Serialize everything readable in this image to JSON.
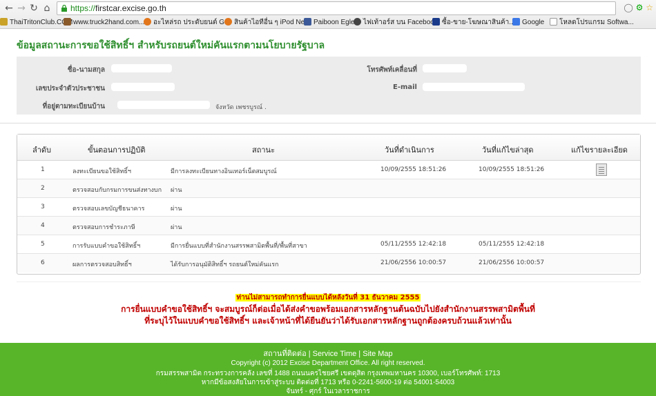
{
  "browser": {
    "url_scheme": "https://",
    "url_host": "firstcar.excise.go.th",
    "bookmarks": [
      {
        "label": "ThaiTritonClub.COM",
        "icon": "car-icon",
        "color": "#c9a227"
      },
      {
        "label": "www.truck2hand.com...",
        "icon": "truck-icon",
        "color": "#8a5a2b"
      },
      {
        "label": "อะไหล่รถ ประดับยนต์ G...",
        "icon": "search-icon",
        "color": "#e2761b"
      },
      {
        "label": "สินค้าไอทีอื่น ๆ iPod Ne...",
        "icon": "search-icon",
        "color": "#e2761b"
      },
      {
        "label": "Paiboon Egle",
        "icon": "facebook-icon",
        "color": "#3b5998"
      },
      {
        "label": "ไฟเท้าอร์ส บน Facebook",
        "icon": "ball-icon",
        "color": "#444444"
      },
      {
        "label": "ซื้อ-ขาย-โฆษณาสินค้า...",
        "icon": "tag-icon",
        "color": "#1a3a8a"
      },
      {
        "label": "Google",
        "icon": "google-icon",
        "color": "#3b78e7"
      },
      {
        "label": "โหลดโปรแกรม Softwa...",
        "icon": "page-icon",
        "color": "#dddddd"
      }
    ]
  },
  "page": {
    "title": "ข้อมูลสถานะการขอใช้สิทธิ์ฯ สำหรับรถยนต์ใหม่คันแรกตามนโยบายรัฐบาล"
  },
  "info": {
    "name_label": "ชื่อ-นามสกุล",
    "id_label": "เลขประจำตัวประชาชน",
    "address_label": "ที่อยู่ตามทะเบียนบ้าน",
    "address_province": "จังหวัด เพชรบูรณ์ .",
    "mobile_label": "โทรศัพท์เคลื่อนที่",
    "email_label": "E-mail"
  },
  "table": {
    "headers": {
      "no": "ลำดับ",
      "step": "ขั้นตอนการปฏิบัติ",
      "status": "สถานะ",
      "date_done": "วันที่ดำเนินการ",
      "date_edit": "วันที่แก้ไขล่าสุด",
      "edit": "แก้ไขรายละเอียด"
    },
    "rows": [
      {
        "no": "1",
        "step": "ลงทะเบียนขอใช้สิทธิ์ฯ",
        "status": "มีการลงทะเบียนทางอินเทอร์เน็ตสมบูรณ์",
        "date_done": "10/09/2555 18:51:26",
        "date_edit": "10/09/2555 18:51:26"
      },
      {
        "no": "2",
        "step": "ตรวจสอบกับกรมการขนส่งทางบก",
        "status": "ผ่าน",
        "date_done": "",
        "date_edit": ""
      },
      {
        "no": "3",
        "step": "ตรวจสอบเลขบัญชีธนาคาร",
        "status": "ผ่าน",
        "date_done": "",
        "date_edit": ""
      },
      {
        "no": "4",
        "step": "ตรวจสอบการชำระภาษี",
        "status": "ผ่าน",
        "date_done": "",
        "date_edit": ""
      },
      {
        "no": "5",
        "step": "การรับแบบคำขอใช้สิทธิ์ฯ",
        "status": "มีการยื่นแบบที่สำนักงานสรรพสามิตพื้นที่/พื้นที่สาขา",
        "date_done": "05/11/2555 12:42:18",
        "date_edit": "05/11/2555 12:42:18"
      },
      {
        "no": "6",
        "step": "ผลการตรวจสอบสิทธิ์ฯ",
        "status": "ได้รับการอนุมัติสิทธิ์ฯ รถยนต์ใหม่คันแรก",
        "date_done": "21/06/2556 10:00:57",
        "date_edit": "21/06/2556 10:00:57"
      }
    ]
  },
  "notice": {
    "deadline": "ท่านไม่สามารถทำการยื่นแบบได้หลังวันที่ 31 ธันวาคม 2555",
    "line1": "การยื่นแบบคำขอใช้สิทธิ์ฯ จะสมบูรณ์ก็ต่อเมื่อได้ส่งคำขอพร้อมเอกสารหลักฐานต้นฉบับไปยังสำนักงานสรรพสามิตพื้นที่",
    "line2": "ที่ระบุไว้ในแบบคำขอใช้สิทธิ์ฯ และเจ้าหน้าที่ได้ยืนยันว่าได้รับเอกสารหลักฐานถูกต้องครบถ้วนแล้วเท่านั้น"
  },
  "footer": {
    "link_contact": "สถานที่ติดต่อ",
    "link_service": "Service Time",
    "link_sitemap": "Site Map",
    "sep": " | ",
    "copyright": "Copyright (c) 2012 Excise Department Office. All right reserved.",
    "address": "กรมสรรพสามิต กระทรวงการคลัง เลขที่ 1488 ถนนนครไชยศรี เขตดุสิต กรุงเทพมหานคร 10300, เบอร์โทรศัพท์: 1713",
    "contact": "หากมีข้อสงสัยในการเข้าสู่ระบบ ติดต่อที่ 1713 หรือ 0-2241-5600-19 ต่อ 54001-54003",
    "hours": "จันทร์ - ศุกร์ ในเวลาราชการ"
  },
  "colors": {
    "title_green": "#2f8f2f",
    "footer_green": "#58b52a",
    "notice_red": "#c00000",
    "highlight_yellow": "#ffff00"
  }
}
